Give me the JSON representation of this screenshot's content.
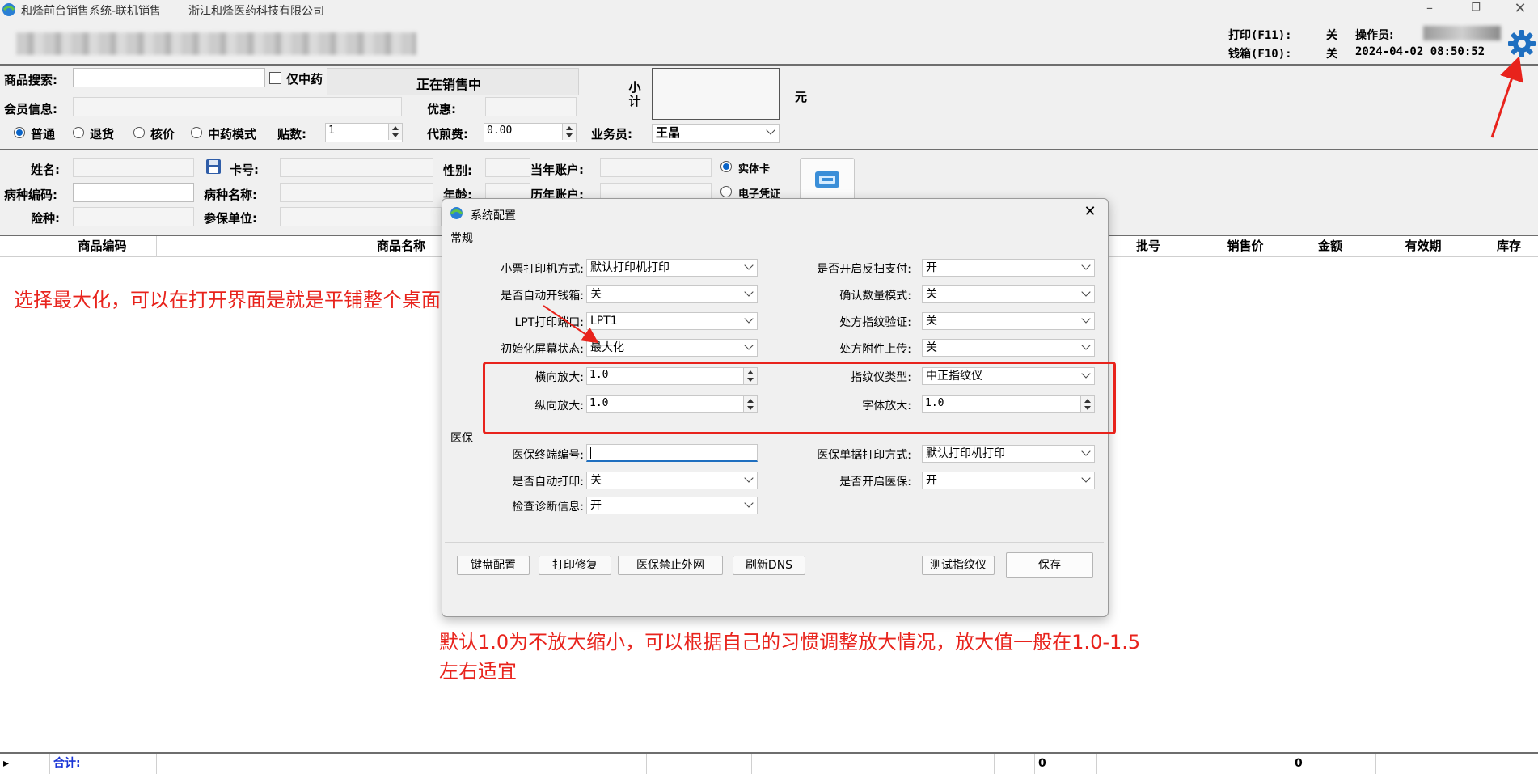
{
  "window": {
    "title": "和烽前台销售系统-联机销售",
    "company": "浙江和烽医药科技有限公司"
  },
  "header": {
    "print_label": "打印(F11):",
    "print_value": "关",
    "drawer_label": "钱箱(F10):",
    "drawer_value": "关",
    "operator_label": "操作员:",
    "datetime": "2024-04-02 08:50:52"
  },
  "search": {
    "label": "商品搜索:",
    "only_tcm": "仅中药",
    "status": "正在销售中",
    "member_label": "会员信息:",
    "discount_label": "优惠:",
    "subtotal_label": "小计",
    "currency": "元",
    "modes": [
      "普通",
      "退货",
      "核价",
      "中药模式"
    ],
    "selected_mode": "普通",
    "doses_label": "贴数:",
    "doses_value": "1",
    "proxy_fee_label": "代煎费:",
    "proxy_fee_value": "0.00",
    "salesman_label": "业务员:",
    "salesman_value": "王晶"
  },
  "insurance": {
    "name_label": "姓名:",
    "card_label": "卡号:",
    "gender_label": "性别:",
    "cur_account_label": "当年账户:",
    "disease_code_label": "病种编码:",
    "disease_name_label": "病种名称:",
    "age_label": "年龄:",
    "hist_account_label": "历年账户:",
    "type_label": "险种:",
    "unit_label": "参保单位:",
    "card_options": [
      "实体卡",
      "电子凭证"
    ],
    "selected_card": "实体卡"
  },
  "grid": {
    "columns": [
      "商品编码",
      "商品名称",
      "批号",
      "销售价",
      "金额",
      "有效期",
      "库存"
    ],
    "total_label": "合计:",
    "total_values": [
      "0",
      "0"
    ]
  },
  "dialog": {
    "title": "系统配置",
    "section_general": "常规",
    "section_insurance": "医保",
    "general_left": [
      {
        "label": "小票打印机方式:",
        "value": "默认打印机打印"
      },
      {
        "label": "是否自动开钱箱:",
        "value": "关"
      },
      {
        "label": "LPT打印端口:",
        "value": "LPT1"
      },
      {
        "label": "初始化屏幕状态:",
        "value": "最大化"
      }
    ],
    "general_right": [
      {
        "label": "是否开启反扫支付:",
        "value": "开"
      },
      {
        "label": "确认数量模式:",
        "value": "关"
      },
      {
        "label": "处方指纹验证:",
        "value": "关"
      },
      {
        "label": "处方附件上传:",
        "value": "关"
      }
    ],
    "h_zoom_label": "横向放大:",
    "h_zoom_value": "1.0",
    "v_zoom_label": "纵向放大:",
    "v_zoom_value": "1.0",
    "fp_type_label": "指纹仪类型:",
    "fp_type_value": "中正指纹仪",
    "font_zoom_label": "字体放大:",
    "font_zoom_value": "1.0",
    "terminal_label": "医保终端编号:",
    "terminal_value": "",
    "auto_print_label": "是否自动打印:",
    "auto_print_value": "关",
    "check_diag_label": "检查诊断信息:",
    "check_diag_value": "开",
    "bill_print_label": "医保单据打印方式:",
    "bill_print_value": "默认打印机打印",
    "enable_ins_label": "是否开启医保:",
    "enable_ins_value": "开",
    "buttons": [
      "键盘配置",
      "打印修复",
      "医保禁止外网",
      "刷新DNS"
    ],
    "test_fp": "测试指纹仪",
    "save": "保存"
  },
  "annotations": {
    "maximize_note": "选择最大化，可以在打开界面是就是平铺整个桌面",
    "zoom_note_line1": "默认1.0为不放大缩小，可以根据自己的习惯调整放大情况，放大值一般在1.0-1.5",
    "zoom_note_line2": "左右适宜",
    "color": "#e8231c"
  }
}
